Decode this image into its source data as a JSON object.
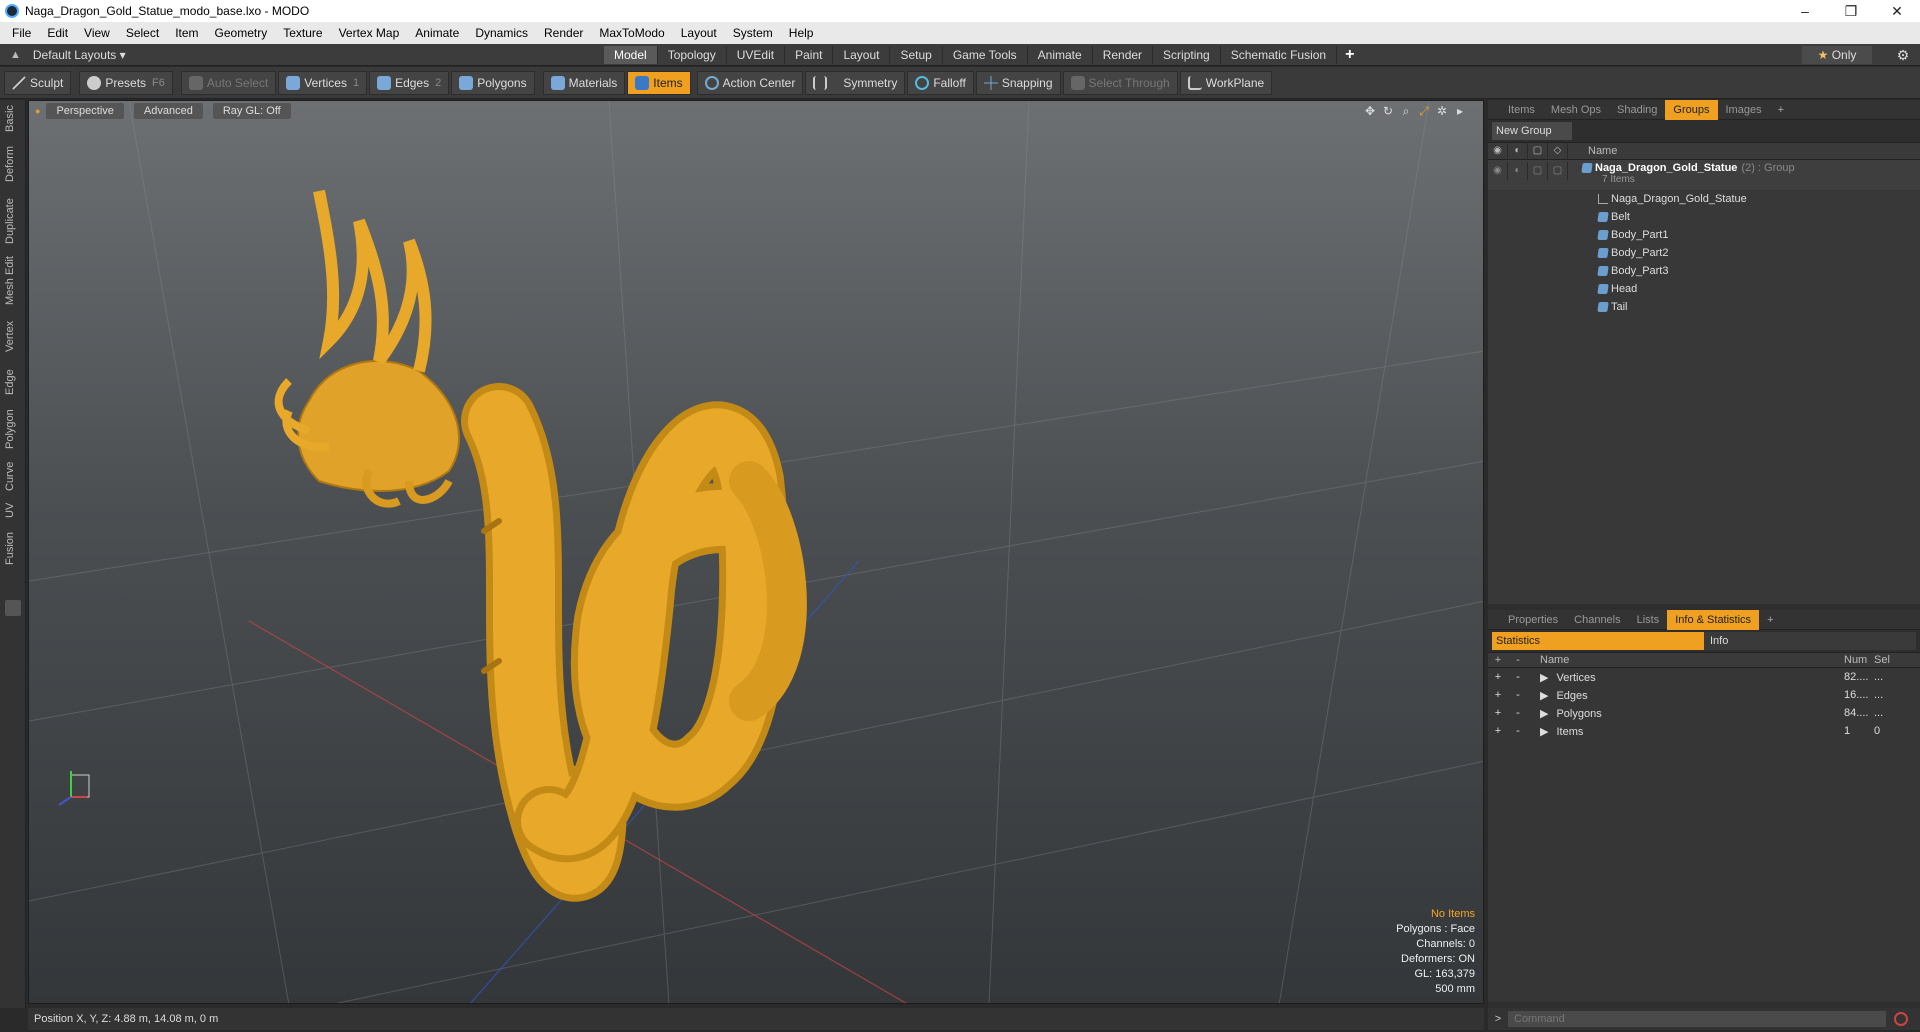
{
  "window": {
    "title": "Naga_Dragon_Gold_Statue_modo_base.lxo - MODO",
    "minimize": "–",
    "maximize": "❐",
    "close": "✕"
  },
  "menu": [
    "File",
    "Edit",
    "View",
    "Select",
    "Item",
    "Geometry",
    "Texture",
    "Vertex Map",
    "Animate",
    "Dynamics",
    "Render",
    "MaxToModo",
    "Layout",
    "System",
    "Help"
  ],
  "layout": {
    "default_layouts": "Default Layouts ▾",
    "tabs": [
      "Model",
      "Topology",
      "UVEdit",
      "Paint",
      "Layout",
      "Setup",
      "Game Tools",
      "Animate",
      "Render",
      "Scripting",
      "Schematic Fusion"
    ],
    "active_tab": "Model",
    "plus": "+",
    "only_star": "★",
    "only_label": "Only",
    "gear": "⚙"
  },
  "toolbar": {
    "sculpt": "Sculpt",
    "presets": "Presets",
    "presets_key": "F6",
    "auto_select": "Auto Select",
    "vertices": "Vertices",
    "vertices_key": "1",
    "edges": "Edges",
    "edges_key": "2",
    "polygons": "Polygons",
    "materials": "Materials",
    "items": "Items",
    "action_center": "Action Center",
    "symmetry": "Symmetry",
    "falloff": "Falloff",
    "snapping": "Snapping",
    "select_through": "Select Through",
    "workplane": "WorkPlane"
  },
  "left_strip": [
    "Basic",
    "Deform",
    "Duplicate",
    "Mesh Edit",
    "Vertex",
    "Edge",
    "Polygon",
    "Curve",
    "UV",
    "Fusion"
  ],
  "viewport": {
    "view": "Perspective",
    "shading": "Advanced",
    "raygl": "Ray GL: Off",
    "info": {
      "no_items": "No Items",
      "polygons": "Polygons : Face",
      "channels": "Channels: 0",
      "deformers": "Deformers: ON",
      "gl": "GL: 163,379",
      "scale": "500 mm"
    }
  },
  "groups_panel": {
    "tabs": [
      "Items",
      "Mesh Ops",
      "Shading",
      "Groups",
      "Images"
    ],
    "active": "Groups",
    "plus": "+",
    "new_group": "New Group",
    "name_header": "Name",
    "group_name": "Naga_Dragon_Gold_Statue",
    "group_suffix": "(2) : Group",
    "group_count": "7 Items",
    "children": [
      "Naga_Dragon_Gold_Statue",
      "Belt",
      "Body_Part1",
      "Body_Part2",
      "Body_Part3",
      "Head",
      "Tail"
    ]
  },
  "stats_panel": {
    "tabs": [
      "Properties",
      "Channels",
      "Lists",
      "Info & Statistics"
    ],
    "active": "Info & Statistics",
    "plus": "+",
    "statistics": "Statistics",
    "info": "Info",
    "headers": {
      "name": "Name",
      "num": "Num",
      "sel": "Sel"
    },
    "rows": [
      {
        "name": "Vertices",
        "num": "82....",
        "sel": "..."
      },
      {
        "name": "Edges",
        "num": "16....",
        "sel": "..."
      },
      {
        "name": "Polygons",
        "num": "84....",
        "sel": "..."
      },
      {
        "name": "Items",
        "num": "1",
        "sel": "0"
      }
    ]
  },
  "statusbar": {
    "position": "Position X, Y, Z:   4.88 m, 14.08 m, 0 m"
  },
  "command": {
    "placeholder": "Command"
  },
  "colors": {
    "accent": "#f0a020",
    "gold": "#e8a92a"
  }
}
